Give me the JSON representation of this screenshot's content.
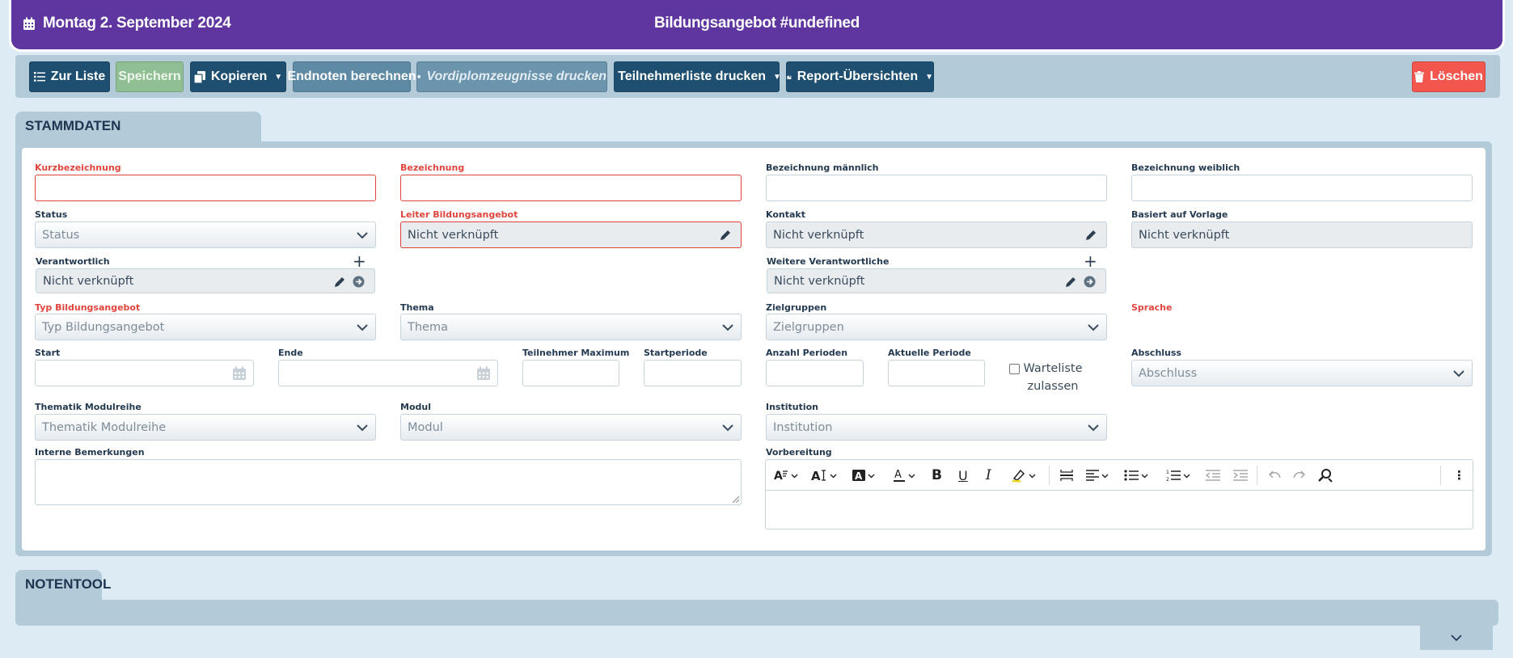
{
  "header": {
    "date": "Montag 2. September 2024",
    "title": "Bildungsangebot #undefined"
  },
  "toolbar": {
    "to_list": "Zur Liste",
    "save": "Speichern",
    "copy": "Kopieren",
    "final_grades": "Endnoten berechnen",
    "pre_diploma": "Vordiplomzeugnisse drucken",
    "participant_list": "Teilnehmerliste drucken",
    "reports": "Report-Übersichten",
    "delete": "Löschen"
  },
  "tabs": {
    "stammdaten": "STAMMDATEN",
    "notentool": "NOTENTOOL"
  },
  "form": {
    "kurzbezeichnung": {
      "label": "Kurzbezeichnung",
      "value": ""
    },
    "bezeichnung": {
      "label": "Bezeichnung",
      "value": ""
    },
    "bezeichnung_m": {
      "label": "Bezeichnung männlich",
      "value": ""
    },
    "bezeichnung_w": {
      "label": "Bezeichnung weiblich",
      "value": ""
    },
    "status": {
      "label": "Status",
      "placeholder": "Status"
    },
    "leiter": {
      "label": "Leiter Bildungsangebot",
      "value": "Nicht verknüpft"
    },
    "kontakt": {
      "label": "Kontakt",
      "value": "Nicht verknüpft"
    },
    "vorlage": {
      "label": "Basiert auf Vorlage",
      "value": "Nicht verknüpft"
    },
    "verantwortlich": {
      "label": "Verantwortlich",
      "value": "Nicht verknüpft"
    },
    "weitere": {
      "label": "Weitere Verantwortliche",
      "value": "Nicht verknüpft"
    },
    "typ": {
      "label": "Typ Bildungsangebot",
      "placeholder": "Typ Bildungsangebot"
    },
    "thema": {
      "label": "Thema",
      "placeholder": "Thema"
    },
    "zielgruppen": {
      "label": "Zielgruppen",
      "placeholder": "Zielgruppen"
    },
    "sprache": {
      "label": "Sprache"
    },
    "start": {
      "label": "Start"
    },
    "ende": {
      "label": "Ende"
    },
    "tn_max": {
      "label": "Teilnehmer Maximum"
    },
    "startperiode": {
      "label": "Startperiode"
    },
    "anzahl_perioden": {
      "label": "Anzahl Perioden"
    },
    "aktuelle_periode": {
      "label": "Aktuelle Periode"
    },
    "warteliste": {
      "line1": "Warteliste",
      "line2": "zulassen",
      "checked": false
    },
    "abschluss": {
      "label": "Abschluss",
      "placeholder": "Abschluss"
    },
    "thematik": {
      "label": "Thematik Modulreihe",
      "placeholder": "Thematik Modulreihe"
    },
    "modul": {
      "label": "Modul",
      "placeholder": "Modul"
    },
    "institution": {
      "label": "Institution",
      "placeholder": "Institution"
    },
    "bemerkungen": {
      "label": "Interne Bemerkungen"
    },
    "vorbereitung": {
      "label": "Vorbereitung"
    }
  },
  "colors": {
    "header": "#5f35a0",
    "required": "#e0453d",
    "primary_button": "#1e4f70",
    "delete_button": "#f2564d"
  }
}
